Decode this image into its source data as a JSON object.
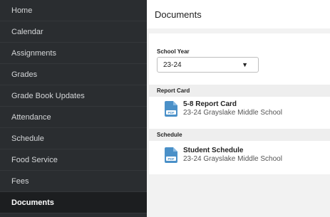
{
  "sidebar": {
    "items": [
      {
        "label": "Home"
      },
      {
        "label": "Calendar"
      },
      {
        "label": "Assignments"
      },
      {
        "label": "Grades"
      },
      {
        "label": "Grade Book Updates"
      },
      {
        "label": "Attendance"
      },
      {
        "label": "Schedule"
      },
      {
        "label": "Food Service"
      },
      {
        "label": "Fees"
      },
      {
        "label": "Documents"
      }
    ],
    "active": "Documents"
  },
  "header": {
    "title": "Documents"
  },
  "school_year": {
    "label": "School Year",
    "selected": "23-24"
  },
  "sections": [
    {
      "header": "Report Card",
      "document": {
        "title": "5-8 Report Card",
        "subtitle": "23-24 Grayslake Middle School",
        "icon": "pdf-file-icon"
      }
    },
    {
      "header": "Schedule",
      "document": {
        "title": "Student Schedule",
        "subtitle": "23-24 Grayslake Middle School",
        "icon": "pdf-file-icon"
      }
    }
  ],
  "colors": {
    "sidebar_bg": "#2a2d30",
    "sidebar_active_bg": "#1c1e20",
    "pdf_icon": "#4a90c8"
  }
}
